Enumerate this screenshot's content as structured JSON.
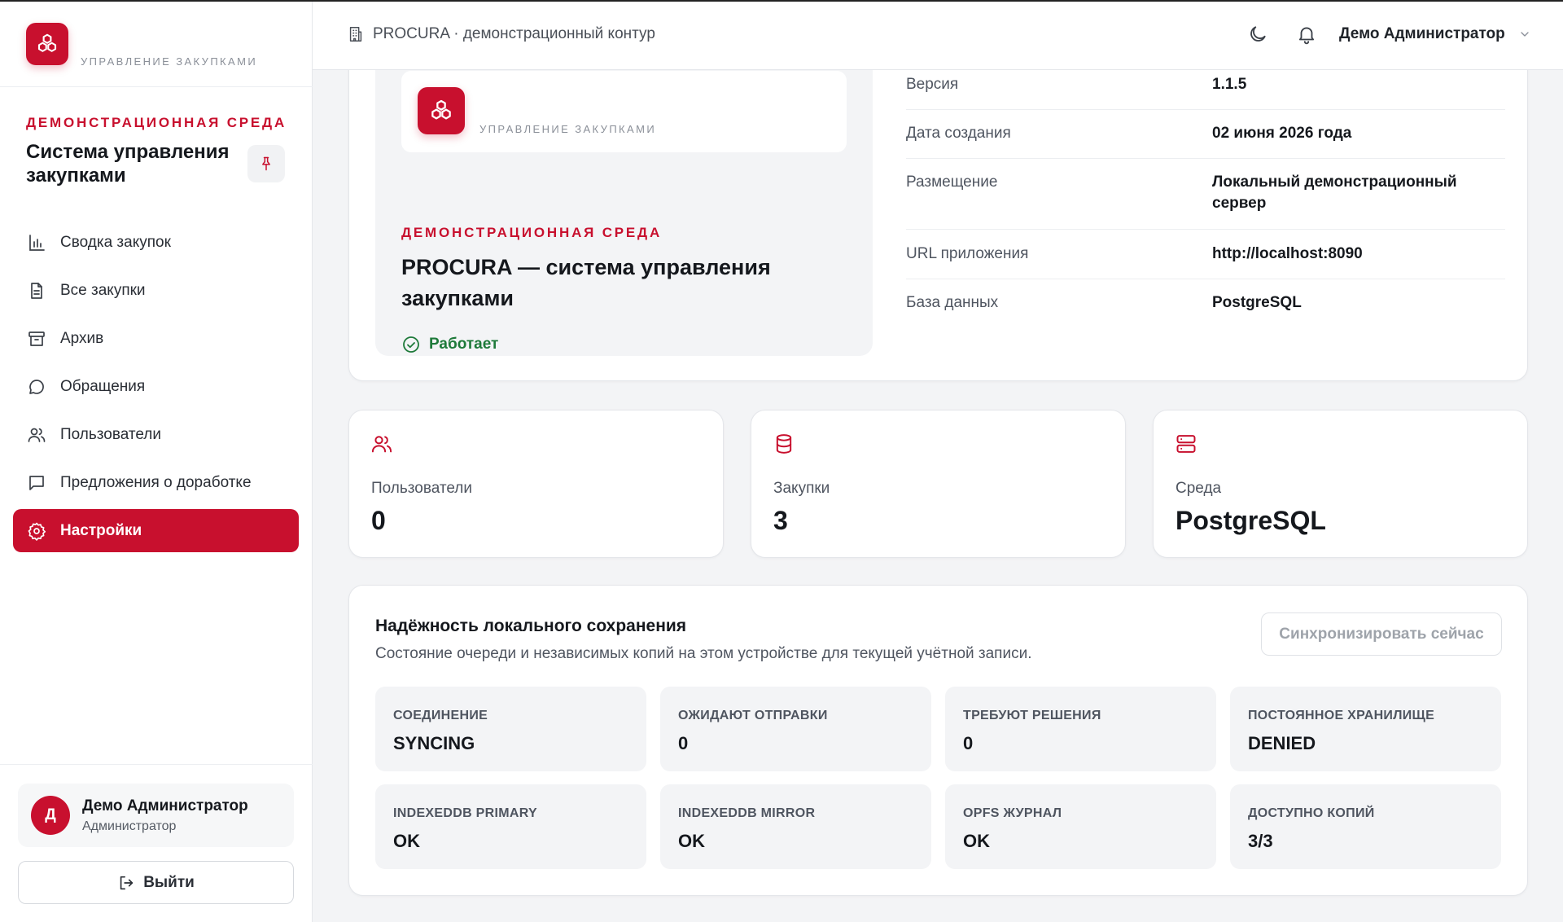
{
  "brand": {
    "caption": "УПРАВЛЕНИЕ ЗАКУПКАМИ",
    "env_label": "ДЕМОНСТРАЦИОННАЯ СРЕДА",
    "title": "Система управления закупками"
  },
  "sidebar": {
    "items": [
      {
        "label": "Сводка закупок",
        "icon": "bar-chart-icon",
        "active": false
      },
      {
        "label": "Все закупки",
        "icon": "document-icon",
        "active": false
      },
      {
        "label": "Архив",
        "icon": "archive-icon",
        "active": false
      },
      {
        "label": "Обращения",
        "icon": "chat-bubble-icon",
        "active": false
      },
      {
        "label": "Пользователи",
        "icon": "users-icon",
        "active": false
      },
      {
        "label": "Предложения о доработке",
        "icon": "message-square-icon",
        "active": false
      },
      {
        "label": "Настройки",
        "icon": "gear-icon",
        "active": true
      }
    ],
    "user": {
      "initial": "Д",
      "name": "Демо Администратор",
      "role": "Администратор"
    },
    "logout_label": "Выйти"
  },
  "topbar": {
    "breadcrumb": "PROCURA · демонстрационный контур",
    "user_name": "Демо Администратор"
  },
  "about": {
    "caption": "УПРАВЛЕНИЕ ЗАКУПКАМИ",
    "env_label": "ДЕМОНСТРАЦИОННАЯ СРЕДА",
    "title": "PROCURA — система управления закупками",
    "status": "Работает",
    "rows": [
      {
        "label": "Версия",
        "value": "1.1.5"
      },
      {
        "label": "Дата создания",
        "value": "02 июня 2026 года"
      },
      {
        "label": "Размещение",
        "value": "Локальный демонстрационный сервер"
      },
      {
        "label": "URL приложения",
        "value": "http://localhost:8090"
      },
      {
        "label": "База данных",
        "value": "PostgreSQL"
      }
    ]
  },
  "stats": [
    {
      "label": "Пользователи",
      "value": "0",
      "icon": "users-icon"
    },
    {
      "label": "Закупки",
      "value": "3",
      "icon": "database-icon"
    },
    {
      "label": "Среда",
      "value": "PostgreSQL",
      "icon": "server-icon"
    }
  ],
  "sync": {
    "title": "Надёжность локального сохранения",
    "subtitle": "Состояние очереди и независимых копий на этом устройстве для текущей учётной записи.",
    "button_label": "Синхронизировать сейчас",
    "tiles": [
      {
        "label": "СОЕДИНЕНИЕ",
        "value": "SYNCING"
      },
      {
        "label": "ОЖИДАЮТ ОТПРАВКИ",
        "value": "0"
      },
      {
        "label": "ТРЕБУЮТ РЕШЕНИЯ",
        "value": "0"
      },
      {
        "label": "ПОСТОЯННОЕ ХРАНИЛИЩЕ",
        "value": "DENIED"
      },
      {
        "label": "INDEXEDDB PRIMARY",
        "value": "OK"
      },
      {
        "label": "INDEXEDDB MIRROR",
        "value": "OK"
      },
      {
        "label": "OPFS ЖУРНАЛ",
        "value": "OK"
      },
      {
        "label": "ДОСТУПНО КОПИЙ",
        "value": "3/3"
      }
    ]
  },
  "colors": {
    "accent": "#c8102e",
    "success": "#1e7a3a"
  }
}
